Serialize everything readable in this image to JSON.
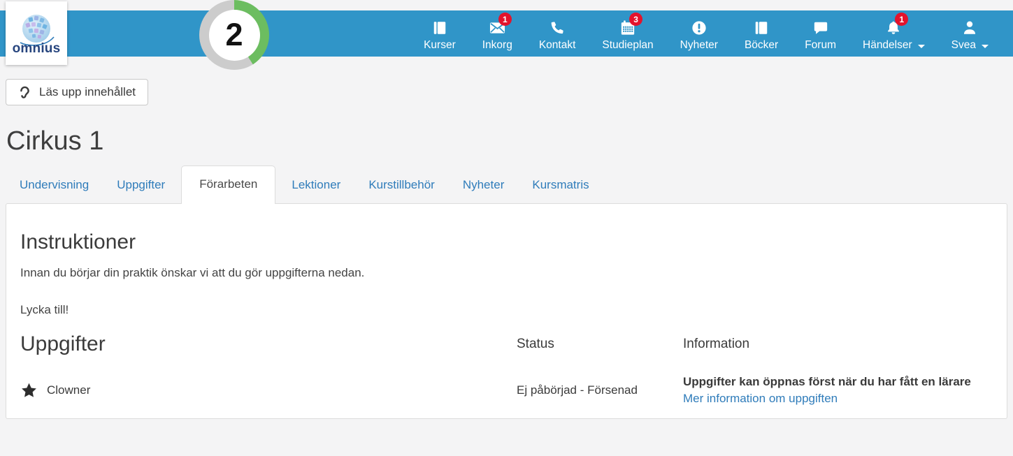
{
  "brand": {
    "name": "omnius"
  },
  "progress_badge": {
    "value": "2",
    "percent_complete": 41
  },
  "navbar": {
    "items": [
      {
        "label": "Kurser",
        "icon": "book-icon"
      },
      {
        "label": "Inkorg",
        "icon": "envelope-icon",
        "badge": "1"
      },
      {
        "label": "Kontakt",
        "icon": "phone-icon"
      },
      {
        "label": "Studieplan",
        "icon": "calendar-icon",
        "badge": "3"
      },
      {
        "label": "Nyheter",
        "icon": "exclamation-circle-icon"
      },
      {
        "label": "Böcker",
        "icon": "book-icon"
      },
      {
        "label": "Forum",
        "icon": "chat-icon"
      },
      {
        "label": "Händelser",
        "icon": "bell-icon",
        "badge": "1",
        "has_dropdown": true
      },
      {
        "label": "Svea",
        "icon": "user-icon",
        "has_dropdown": true
      }
    ]
  },
  "toolbar": {
    "read_aloud_label": "Läs upp innehållet"
  },
  "page": {
    "title": "Cirkus 1"
  },
  "tabs": [
    {
      "label": "Undervisning",
      "active": false
    },
    {
      "label": "Uppgifter",
      "active": false
    },
    {
      "label": "Förarbeten",
      "active": true
    },
    {
      "label": "Lektioner",
      "active": false
    },
    {
      "label": "Kurstillbehör",
      "active": false
    },
    {
      "label": "Nyheter",
      "active": false
    },
    {
      "label": "Kursmatris",
      "active": false
    }
  ],
  "content": {
    "instructions": {
      "title": "Instruktioner",
      "paragraph": "Innan du börjar din praktik önskar vi att du gör uppgifterna nedan.",
      "closing": "Lycka till!"
    },
    "assignments": {
      "title": "Uppgifter",
      "status_header": "Status",
      "information_header": "Information",
      "rows": [
        {
          "name": "Clowner",
          "status": "Ej påbörjad - Försenad",
          "information": "Uppgifter kan öppnas först när du har fått en lärare",
          "link": "Mer information om uppgiften"
        }
      ]
    }
  },
  "colors": {
    "navbar_blue": "#3095c8",
    "badge_red": "#e3132c",
    "progress_green": "#6cbd60",
    "progress_gray": "#cccccc",
    "link_blue": "#2f7cba",
    "page_bg": "#f4f4f5"
  }
}
